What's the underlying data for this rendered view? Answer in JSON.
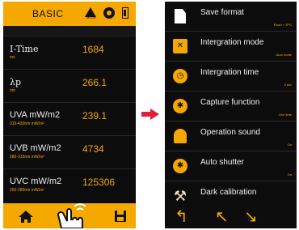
{
  "left_screen": {
    "title": "BASIC",
    "mode_icon_label": "MODE",
    "rows": [
      {
        "name": "I-Time",
        "sub": "ms",
        "value": "1684"
      },
      {
        "name": "λp",
        "sub": "nm",
        "value": "266.1"
      },
      {
        "name": "UVA mW/m2",
        "sub": "315-430nm mW/m²",
        "value": "239.1"
      },
      {
        "name": "UVB mW/m2",
        "sub": "280-315nm mW/m²",
        "value": "4734"
      },
      {
        "name": "UVC mW/m2",
        "sub": "250-280nm mW/m²",
        "value": "125306"
      }
    ]
  },
  "right_screen": {
    "menu": [
      {
        "label": "Save format",
        "value": "Excel + JPG",
        "icon": "file-icon"
      },
      {
        "label": "Intergration mode",
        "value": "Auto mode",
        "icon": "integration-mode-icon"
      },
      {
        "label": "Intergration time",
        "value": "3 sec",
        "icon": "timer-icon"
      },
      {
        "label": "Capture function",
        "value": "One time",
        "icon": "capture-icon"
      },
      {
        "label": "Operation sound",
        "value": "On",
        "icon": "bell-icon"
      },
      {
        "label": "Auto shutter",
        "value": "On",
        "icon": "shutter-icon"
      },
      {
        "label": "Dark calibration",
        "value": "",
        "icon": "tools-icon"
      }
    ]
  },
  "colors": {
    "accent": "#f5a800",
    "background": "#0c0c0c",
    "arrow": "#e0203a"
  }
}
